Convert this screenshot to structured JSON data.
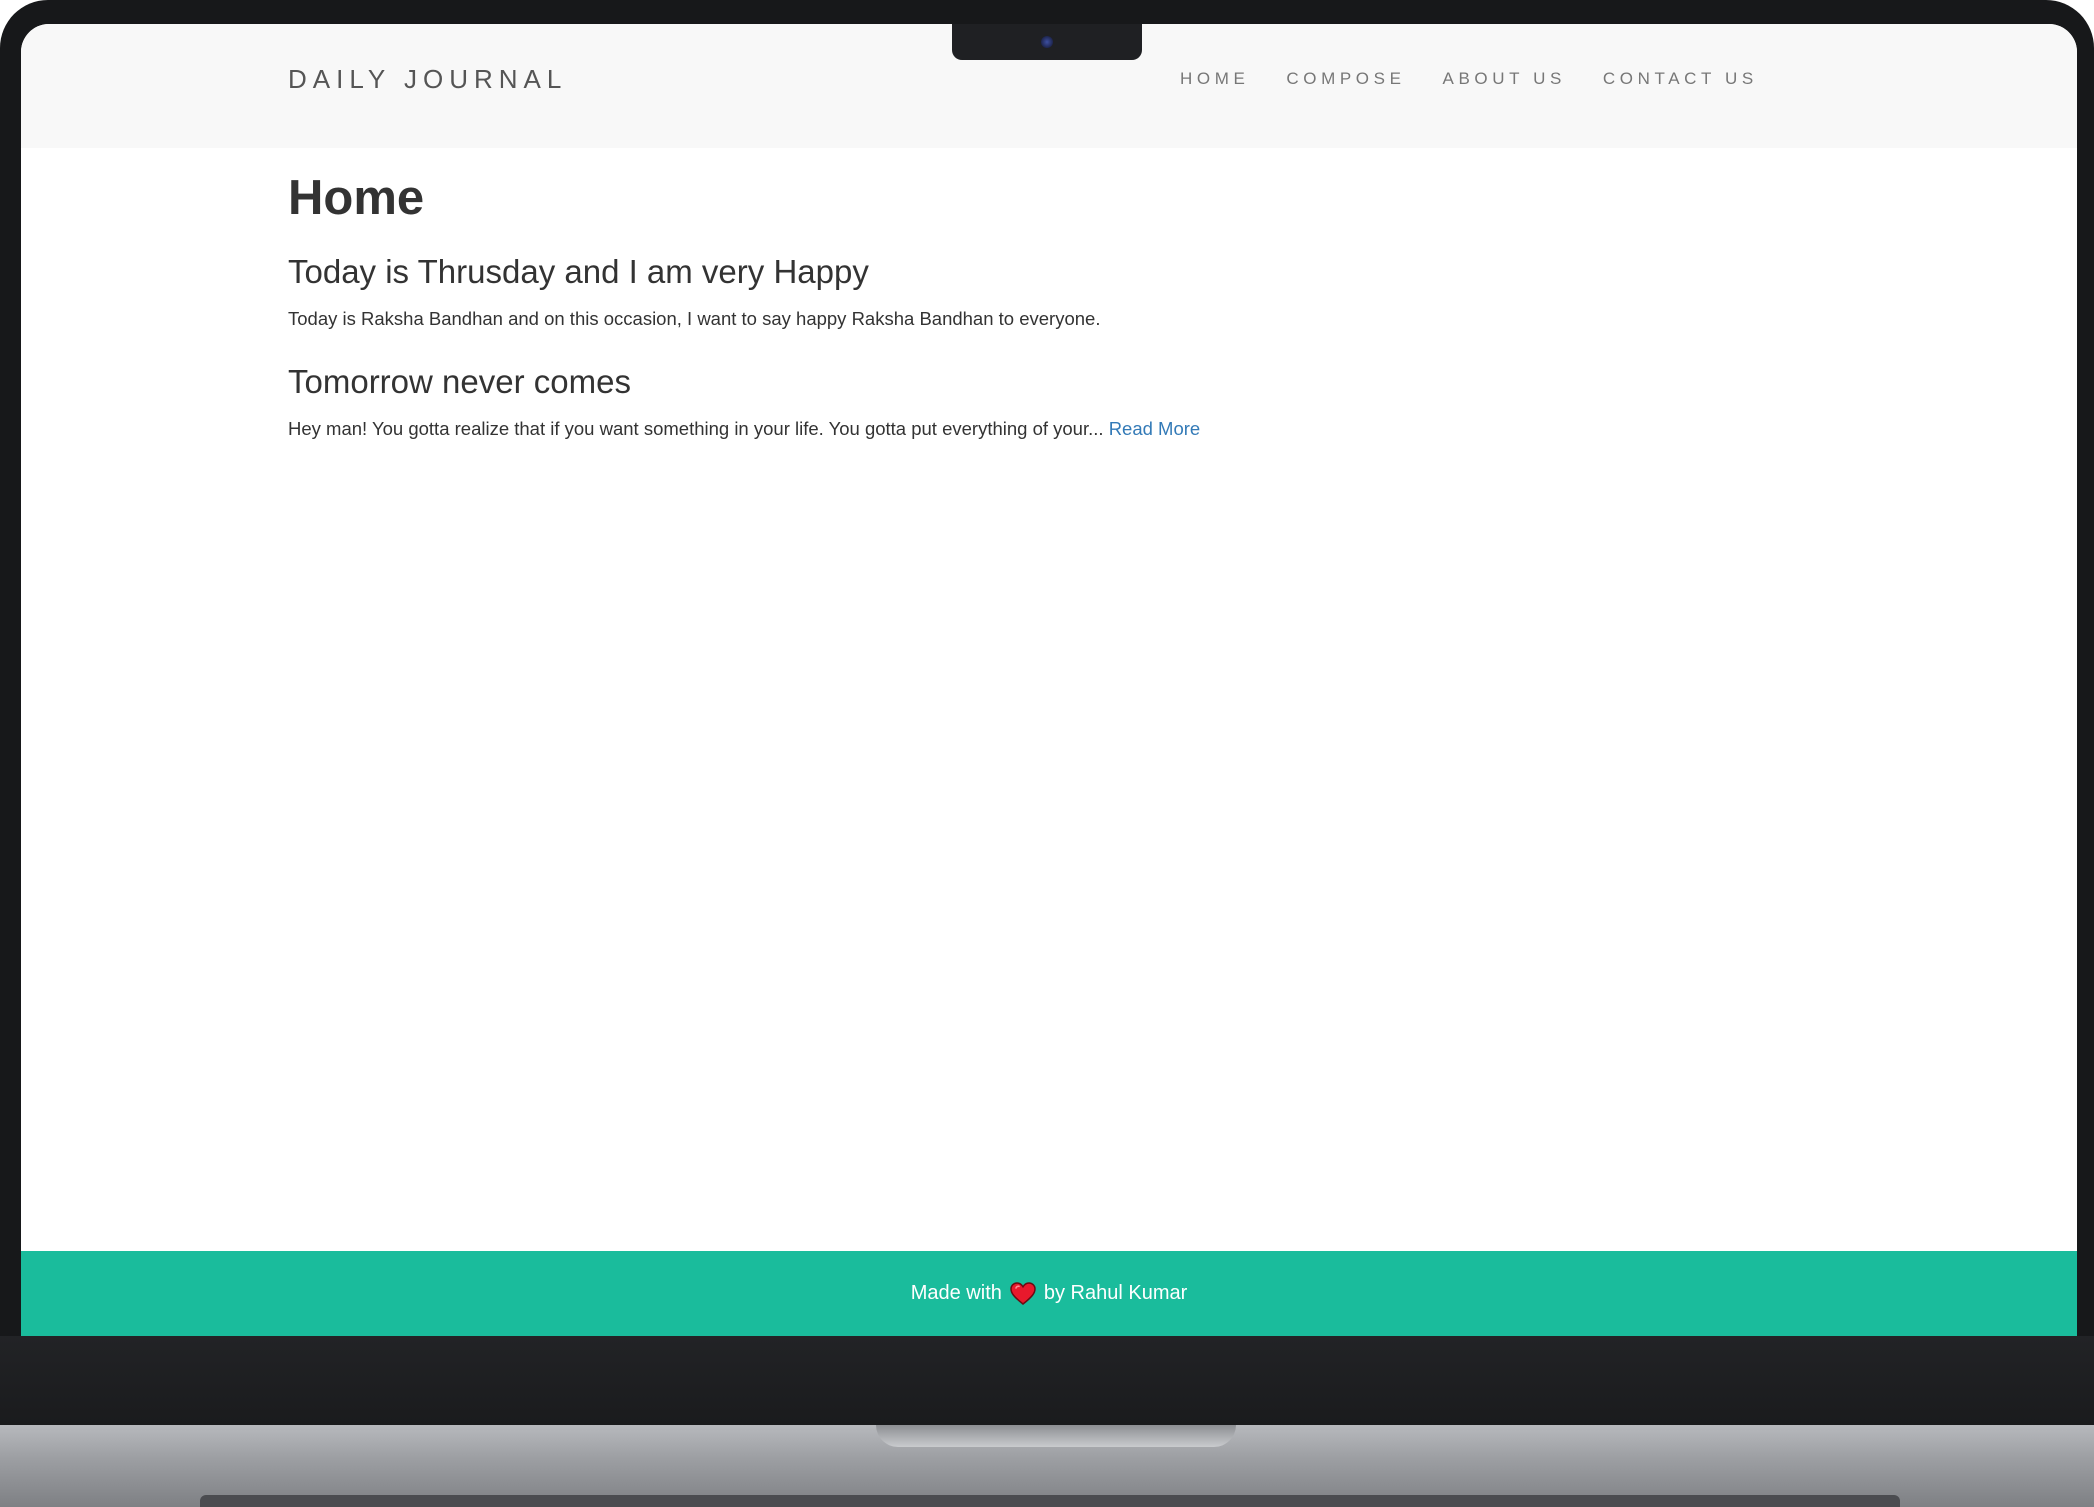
{
  "header": {
    "brand": "DAILY JOURNAL",
    "nav": [
      {
        "label": "HOME"
      },
      {
        "label": "COMPOSE"
      },
      {
        "label": "ABOUT US"
      },
      {
        "label": "CONTACT US"
      }
    ]
  },
  "main": {
    "title": "Home",
    "posts": [
      {
        "title": "Today is Thrusday and I am very Happy",
        "body": "Today is Raksha Bandhan and on this occasion, I want to say happy Raksha Bandhan to everyone.",
        "read_more": ""
      },
      {
        "title": "Tomorrow never comes",
        "body": "Hey man! You gotta realize that if you want something in your life. You gotta put everything of your...",
        "read_more": "Read More"
      }
    ]
  },
  "footer": {
    "prefix": "Made with",
    "icon": "heart-icon",
    "suffix": "by Rahul Kumar"
  },
  "colors": {
    "footer_bg": "#1abc9c",
    "header_bg": "#f8f8f8",
    "link": "#337ab7",
    "heart": "#e8192c"
  }
}
